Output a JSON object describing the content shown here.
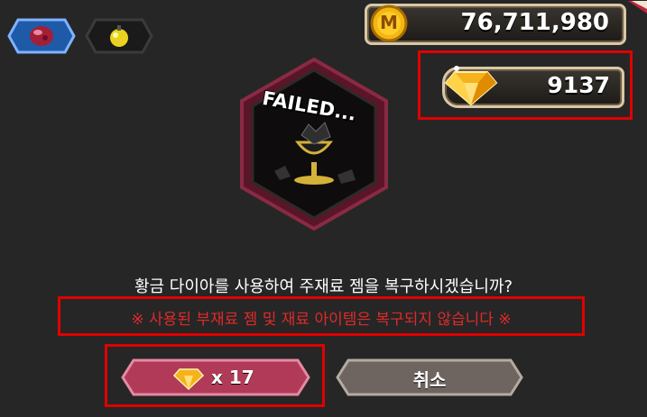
{
  "currency": {
    "gold_icon_letter": "M",
    "gold_amount": "76,711,980",
    "diamond_amount": "9137"
  },
  "result": {
    "status_text": "FAILED..."
  },
  "dialog": {
    "prompt": "황금 다이아를 사용하여 주재료 젬을 복구하시겠습니까?",
    "warning": "※ 사용된 부재료 젬 및 재료 아이템은 복구되지 않습니다 ※"
  },
  "buttons": {
    "restore_multiplier": "x 17",
    "cancel_label": "취소"
  },
  "colors": {
    "highlight_frame": "#e00000",
    "warning_text": "#e02a2a",
    "restore_button": "#b03a58",
    "cancel_button": "#6f6560"
  }
}
